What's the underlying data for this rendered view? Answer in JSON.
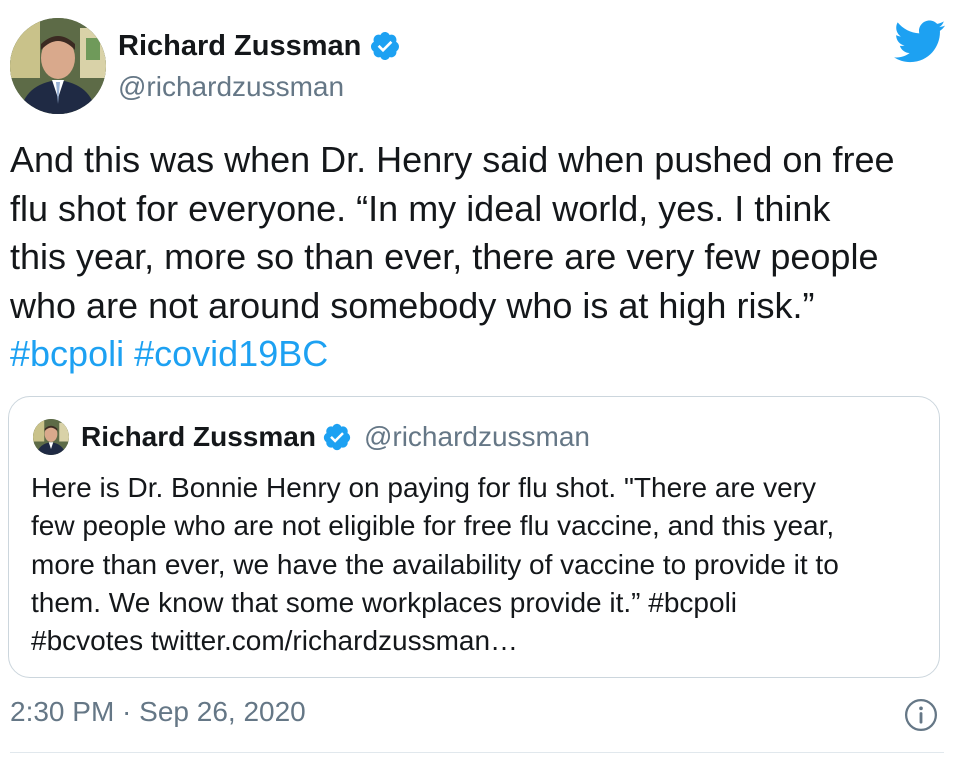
{
  "author": {
    "name": "Richard Zussman",
    "handle": "@richardzussman",
    "verified": true
  },
  "tweet": {
    "text_lines": [
      "And this was when Dr. Henry said when pushed on free",
      "flu shot for everyone. “In my ideal world, yes. I think",
      "this year, more so than ever, there are very few people",
      "who are not around somebody who is at high risk.”"
    ],
    "hashtags": [
      "#bcpoli",
      "#covid19BC"
    ]
  },
  "quoted_tweet": {
    "name": "Richard Zussman",
    "handle": "@richardzussman",
    "text_lines": [
      "Here is Dr. Bonnie Henry on paying for flu shot. \"There are very",
      "few people who are not eligible for free flu vaccine, and this year,",
      "more than ever, we have the availability of vaccine to provide it to",
      "them. We know that some workplaces provide it.” #bcpoli",
      "#bcvotes twitter.com/richardzussman…"
    ]
  },
  "meta": {
    "timestamp": "2:30 PM · Sep 26, 2020"
  },
  "icons": {
    "brand": "twitter-bird-icon",
    "verified": "verified-badge-icon",
    "info": "info-icon"
  },
  "colors": {
    "accent": "#1da1f2",
    "text": "#14171a",
    "secondary": "#657786",
    "border": "#ccd6dd"
  }
}
